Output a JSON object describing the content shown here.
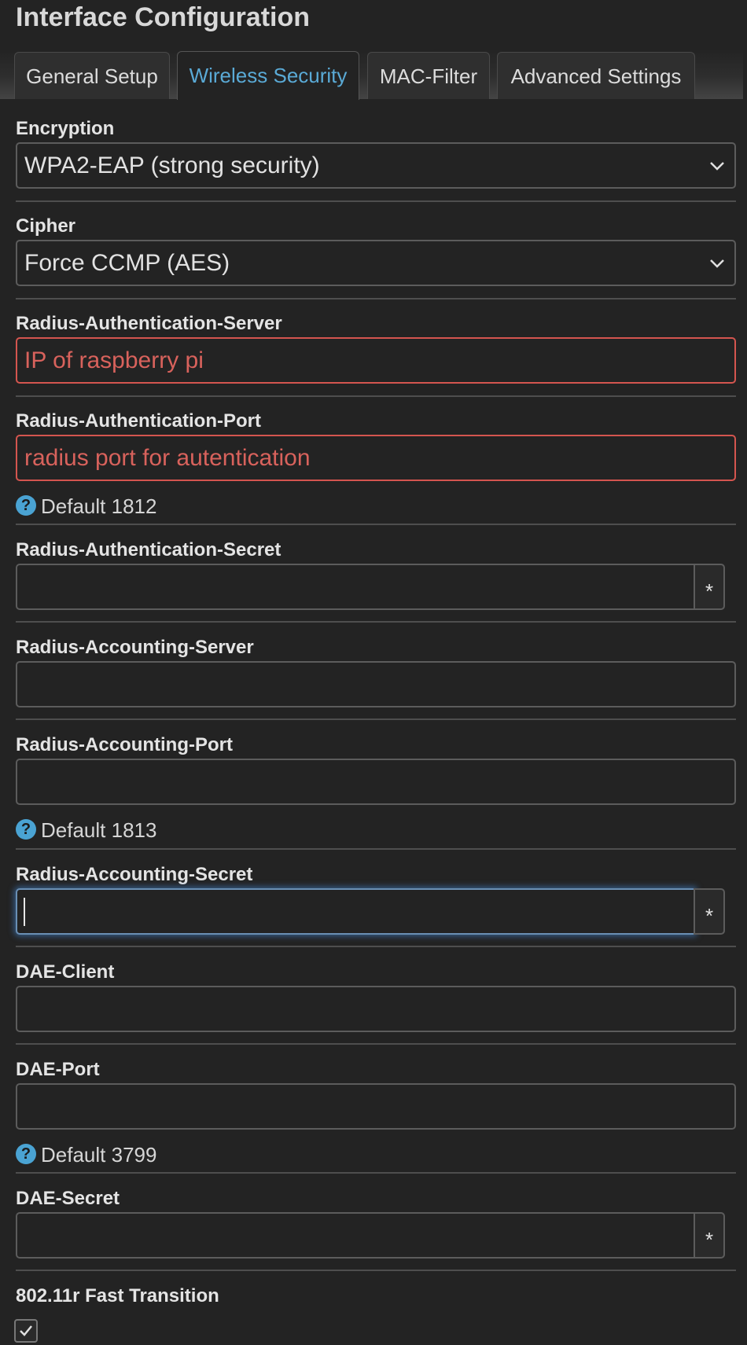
{
  "page": {
    "title": "Interface Configuration"
  },
  "tabs": [
    {
      "label": "General Setup",
      "active": false
    },
    {
      "label": "Wireless Security",
      "active": true
    },
    {
      "label": "MAC-Filter",
      "active": false
    },
    {
      "label": "Advanced Settings",
      "active": false
    }
  ],
  "fields": {
    "encryption": {
      "label": "Encryption",
      "value": "WPA2-EAP (strong security)"
    },
    "cipher": {
      "label": "Cipher",
      "value": "Force CCMP (AES)"
    },
    "auth_server": {
      "label": "Radius-Authentication-Server",
      "value": "IP of raspberry pi"
    },
    "auth_port": {
      "label": "Radius-Authentication-Port",
      "value": "radius port for autentication",
      "hint": "Default 1812"
    },
    "auth_secret": {
      "label": "Radius-Authentication-Secret",
      "value": ""
    },
    "acct_server": {
      "label": "Radius-Accounting-Server",
      "value": ""
    },
    "acct_port": {
      "label": "Radius-Accounting-Port",
      "value": "",
      "hint": "Default 1813"
    },
    "acct_secret": {
      "label": "Radius-Accounting-Secret",
      "value": ""
    },
    "dae_client": {
      "label": "DAE-Client",
      "value": ""
    },
    "dae_port": {
      "label": "DAE-Port",
      "value": "",
      "hint": "Default 3799"
    },
    "dae_secret": {
      "label": "DAE-Secret",
      "value": ""
    },
    "fast_transition": {
      "label": "802.11r Fast Transition",
      "checked": true
    }
  },
  "secret_toggle_label": "*",
  "help_glyph": "?",
  "icons": {
    "select": "chevron-down-icon",
    "help": "help-icon",
    "checkbox": "check-icon"
  },
  "colors": {
    "background": "#232323",
    "active_tab": "#5aaad6",
    "error": "#d8625c",
    "help": "#4aa3d3",
    "focus_glow": "#468cdc"
  }
}
